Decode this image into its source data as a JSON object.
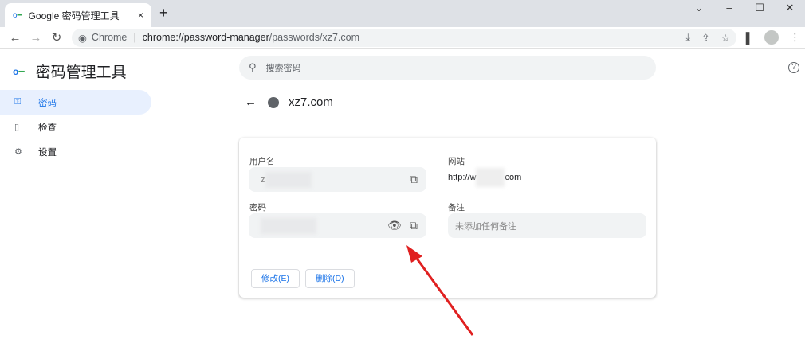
{
  "browser": {
    "tab_title": "Google 密码管理工具",
    "tab_close": "×",
    "new_tab": "+",
    "window_controls": [
      "⌄",
      "–",
      "☐",
      "✕"
    ],
    "omnibox_origin": "Chrome",
    "url_host": "chrome://password-manager",
    "url_path": "/passwords/xz7.com"
  },
  "app": {
    "title": "密码管理工具",
    "search_placeholder": "搜索密码",
    "help": "?"
  },
  "sidebar": {
    "items": [
      {
        "label": "密码",
        "icon": "key-icon",
        "active": true
      },
      {
        "label": "检查",
        "icon": "clipboard-check-icon"
      },
      {
        "label": "设置",
        "icon": "gear-icon"
      }
    ]
  },
  "detail": {
    "site_title": "xz7.com",
    "username_label": "用户名",
    "username_value": "z",
    "password_label": "密码",
    "website_label": "网站",
    "website_prefix": "http://w",
    "website_suffix": "com",
    "note_label": "备注",
    "note_placeholder": "未添加任何备注",
    "edit_button": "修改(E)",
    "delete_button": "删除(D)"
  },
  "colors": {
    "accent": "#1a73e8",
    "annotation_arrow": "#e02020"
  }
}
